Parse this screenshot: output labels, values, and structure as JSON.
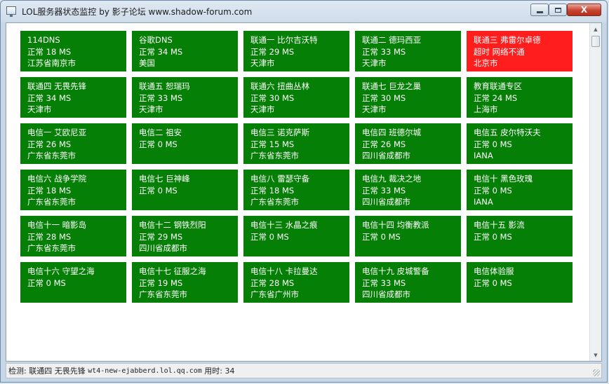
{
  "window": {
    "title": "LOL服务器状态监控 by 影子论坛 www.shadow-forum.com",
    "close_glyph": "X"
  },
  "colors": {
    "up": "#067f06",
    "down": "#ff1e1e"
  },
  "servers": [
    {
      "name": "114DNS",
      "status": "正常 18 MS",
      "location": "江苏省南京市",
      "state": "up"
    },
    {
      "name": "谷歌DNS",
      "status": "正常 34 MS",
      "location": "美国",
      "state": "up"
    },
    {
      "name": "联通一 比尔吉沃特",
      "status": "正常 29 MS",
      "location": "天津市",
      "state": "up"
    },
    {
      "name": "联通二 德玛西亚",
      "status": "正常 33 MS",
      "location": "天津市",
      "state": "up"
    },
    {
      "name": "联通三 弗雷尔卓德",
      "status": "超时 网络不通",
      "location": "北京市",
      "state": "down"
    },
    {
      "name": "联通四 无畏先锋",
      "status": "正常 34 MS",
      "location": "天津市",
      "state": "up"
    },
    {
      "name": "联通五 恕瑞玛",
      "status": "正常 33 MS",
      "location": "天津市",
      "state": "up"
    },
    {
      "name": "联通六 扭曲丛林",
      "status": "正常 30 MS",
      "location": "天津市",
      "state": "up"
    },
    {
      "name": "联通七 巨龙之巢",
      "status": "正常 30 MS",
      "location": "天津市",
      "state": "up"
    },
    {
      "name": "教育联通专区",
      "status": "正常 24 MS",
      "location": "上海市",
      "state": "up"
    },
    {
      "name": "电信一 艾欧尼亚",
      "status": "正常 26 MS",
      "location": "广东省东莞市",
      "state": "up"
    },
    {
      "name": "电信二 祖安",
      "status": "正常 0 MS",
      "location": "",
      "state": "up"
    },
    {
      "name": "电信三 诺克萨斯",
      "status": "正常 15 MS",
      "location": "广东省东莞市",
      "state": "up"
    },
    {
      "name": "电信四 班德尔城",
      "status": "正常 26 MS",
      "location": "四川省成都市",
      "state": "up"
    },
    {
      "name": "电信五 皮尔特沃夫",
      "status": "正常 0 MS",
      "location": "IANA",
      "state": "up"
    },
    {
      "name": "电信六 战争学院",
      "status": "正常 18 MS",
      "location": "广东省东莞市",
      "state": "up"
    },
    {
      "name": "电信七 巨神峰",
      "status": "正常 0 MS",
      "location": "",
      "state": "up"
    },
    {
      "name": "电信八 雷瑟守备",
      "status": "正常 18 MS",
      "location": "广东省东莞市",
      "state": "up"
    },
    {
      "name": "电信九 裁决之地",
      "status": "正常 33 MS",
      "location": "四川省成都市",
      "state": "up"
    },
    {
      "name": "电信十 黑色玫瑰",
      "status": "正常 0 MS",
      "location": "IANA",
      "state": "up"
    },
    {
      "name": "电信十一 暗影岛",
      "status": "正常 28 MS",
      "location": "广东省东莞市",
      "state": "up"
    },
    {
      "name": "电信十二 钢铁烈阳",
      "status": "正常 29 MS",
      "location": "四川省成都市",
      "state": "up"
    },
    {
      "name": "电信十三 水晶之痕",
      "status": "正常 0 MS",
      "location": "",
      "state": "up"
    },
    {
      "name": "电信十四 均衡教派",
      "status": "正常 0 MS",
      "location": "",
      "state": "up"
    },
    {
      "name": "电信十五 影流",
      "status": "正常 0 MS",
      "location": "",
      "state": "up"
    },
    {
      "name": "电信十六 守望之海",
      "status": "正常 0 MS",
      "location": "",
      "state": "up"
    },
    {
      "name": "电信十七 征服之海",
      "status": "正常 19 MS",
      "location": "广东省东莞市",
      "state": "up"
    },
    {
      "name": "电信十八 卡拉曼达",
      "status": "正常 28 MS",
      "location": "广东省广州市",
      "state": "up"
    },
    {
      "name": "电信十九 皮城警备",
      "status": "正常 33 MS",
      "location": "四川省成都市",
      "state": "up"
    },
    {
      "name": "电信体验服",
      "status": "正常 0 MS",
      "location": "",
      "state": "up"
    }
  ],
  "status_bar": {
    "label": "检测:",
    "server": "联通四 无畏先锋",
    "host": "wt4-new-ejabberd.lol.qq.com",
    "time_label": "用时:",
    "time_value": "34"
  }
}
